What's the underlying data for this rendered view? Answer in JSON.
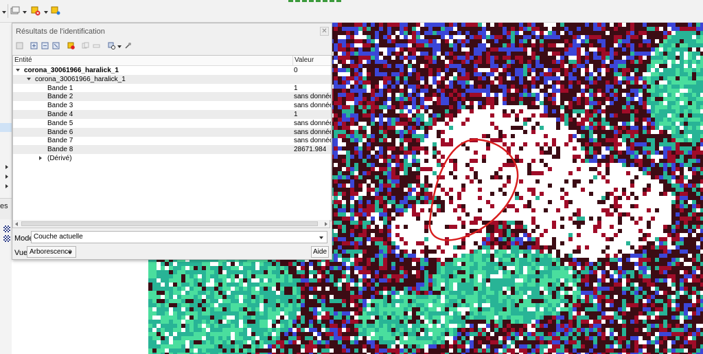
{
  "toolbar": {
    "icons": [
      "layer-icon",
      "identify-results-icon",
      "select-features-icon",
      "label-pin-icon"
    ]
  },
  "left_panel": {
    "label_fragment": "es"
  },
  "dialog": {
    "title": "Résultats de l'identification",
    "close_glyph": "✕",
    "columns": {
      "entity": "Entité",
      "value": "Valeur"
    },
    "rows": [
      {
        "label": "corona_30061966_haralick_1",
        "value": "0",
        "level": 0,
        "bold": true,
        "expanded": true
      },
      {
        "label": "corona_30061966_haralick_1",
        "value": "",
        "level": 1,
        "bold": false,
        "expanded": true
      },
      {
        "label": "Bande 1",
        "value": "1",
        "level": 2
      },
      {
        "label": "Bande 2",
        "value": "sans donnée",
        "level": 2
      },
      {
        "label": "Bande 3",
        "value": "sans donnée",
        "level": 2
      },
      {
        "label": "Bande 4",
        "value": "1",
        "level": 2
      },
      {
        "label": "Bande 5",
        "value": "sans donnée",
        "level": 2
      },
      {
        "label": "Bande 6",
        "value": "sans donnée",
        "level": 2
      },
      {
        "label": "Bande 7",
        "value": "sans donnée",
        "level": 2
      },
      {
        "label": "Bande 8",
        "value": "28671.984",
        "level": 2
      },
      {
        "label": "(Dérivé)",
        "value": "",
        "level": 2,
        "collapsed": true
      }
    ],
    "mode_label": "Mode",
    "mode_value": "Couche actuelle",
    "view_label": "Vue",
    "view_value": "Arborescence",
    "help_label": "Aide"
  },
  "map": {
    "colors": {
      "dark_red": "#3c0c14",
      "crimson": "#a00c28",
      "white": "#ffffff",
      "blue": "#3c46d8",
      "teal": "#28b496",
      "mint": "#4ade9e",
      "annotation": "#d81e1e"
    }
  }
}
